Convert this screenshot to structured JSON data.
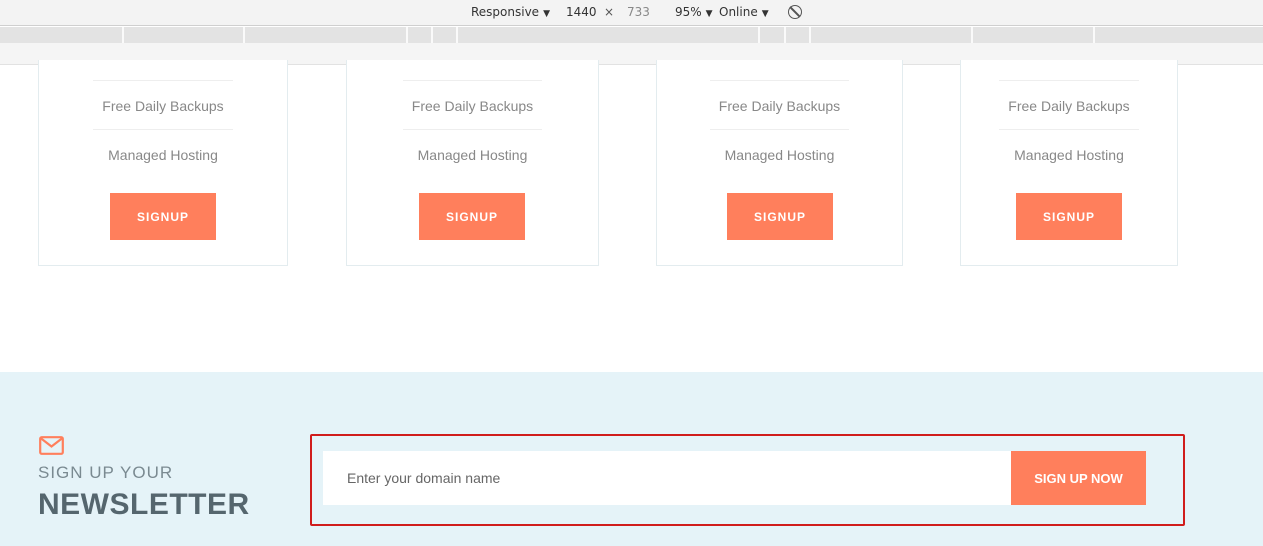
{
  "devtools": {
    "device": "Responsive",
    "width": "1440",
    "times": "×",
    "height": "733",
    "zoom": "95%",
    "network": "Online",
    "caret": "▼"
  },
  "cards": [
    {
      "feature1": "Free Daily Backups",
      "feature2": "Managed Hosting",
      "button": "SIGNUP"
    },
    {
      "feature1": "Free Daily Backups",
      "feature2": "Managed Hosting",
      "button": "SIGNUP"
    },
    {
      "feature1": "Free Daily Backups",
      "feature2": "Managed Hosting",
      "button": "SIGNUP"
    },
    {
      "feature1": "Free Daily Backups",
      "feature2": "Managed Hosting",
      "button": "SIGNUP"
    }
  ],
  "newsletter": {
    "icon": "mail-icon",
    "subtitle": "SIGN UP YOUR",
    "title": "NEWSLETTER",
    "input_placeholder": "Enter your domain name",
    "button": "SIGN UP NOW"
  },
  "colors": {
    "accent": "#ff7f5c",
    "newsletter_bg": "#e5f3f8",
    "highlight_border": "#d01c1c"
  }
}
